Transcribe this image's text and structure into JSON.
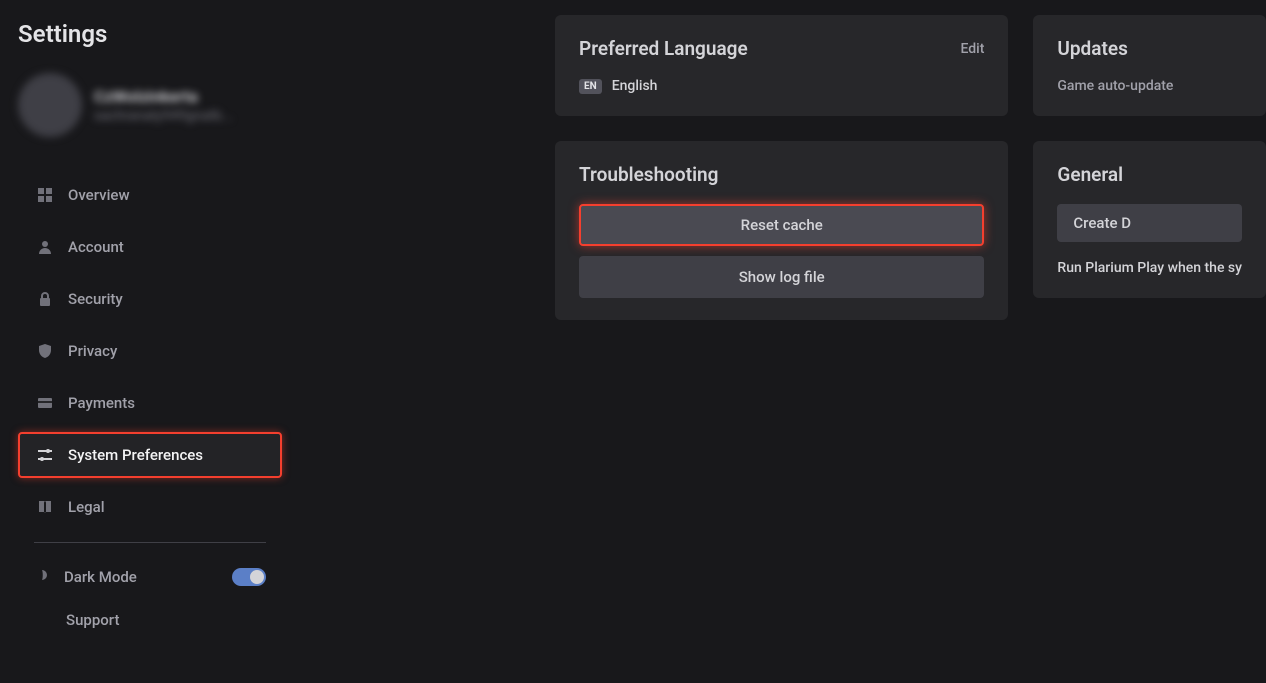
{
  "page_title": "Settings",
  "profile": {
    "name": "CzWolzinkerta",
    "email": "sachranaty949gnatb..."
  },
  "sidebar": {
    "items": [
      {
        "label": "Overview"
      },
      {
        "label": "Account"
      },
      {
        "label": "Security"
      },
      {
        "label": "Privacy"
      },
      {
        "label": "Payments"
      },
      {
        "label": "System Preferences"
      },
      {
        "label": "Legal"
      }
    ],
    "dark_mode_label": "Dark Mode",
    "support_label": "Support"
  },
  "language_card": {
    "title": "Preferred Language",
    "edit": "Edit",
    "badge": "EN",
    "name": "English"
  },
  "troubleshooting_card": {
    "title": "Troubleshooting",
    "reset_cache": "Reset cache",
    "show_log": "Show log file"
  },
  "updates_card": {
    "title": "Updates",
    "auto_update": "Game auto-update"
  },
  "general_card": {
    "title": "General",
    "create_shortcut": "Create D",
    "run_text": "Run Plarium Play when the sy"
  }
}
